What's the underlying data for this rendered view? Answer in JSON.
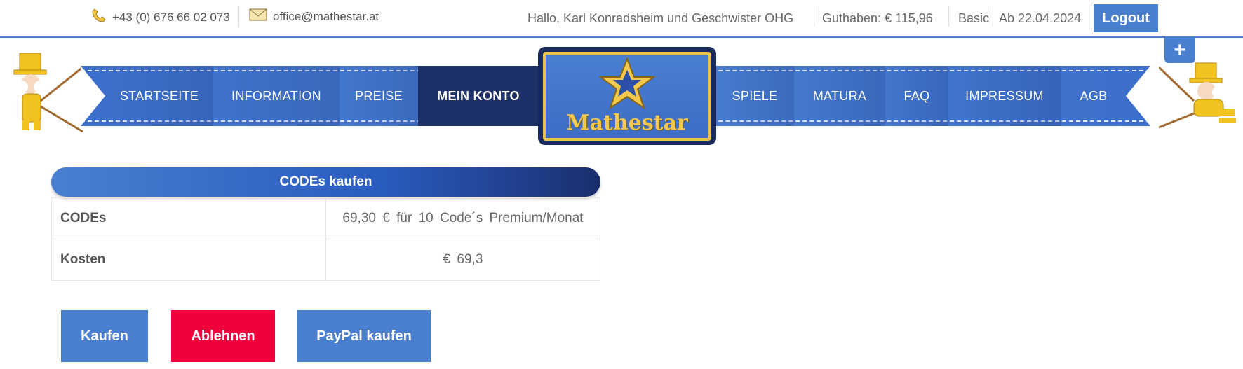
{
  "topbar": {
    "phone": "+43 (0) 676 66 02 073",
    "email": "office@mathestar.at",
    "greeting": "Hallo, Karl Konradsheim und Geschwister OHG",
    "balance": "Guthaben: € 115,96",
    "plan": "Basic",
    "since": "Ab 22.04.2024",
    "logout_label": "Logout",
    "plus_label": "+"
  },
  "nav": {
    "left": [
      "STARTSEITE",
      "INFORMATION",
      "PREISE",
      "MEIN KONTO"
    ],
    "right": [
      "SPIELE",
      "MATURA",
      "FAQ",
      "IMPRESSUM",
      "AGB"
    ],
    "active": "MEIN KONTO"
  },
  "logo": {
    "text": "Mathestar"
  },
  "codes": {
    "header": "CODEs kaufen",
    "rows": [
      {
        "label": "CODEs",
        "value": "69,30 € für 10 Code´s Premium/Monat"
      },
      {
        "label": "Kosten",
        "value": "€ 69,3"
      }
    ]
  },
  "actions": {
    "buy": "Kaufen",
    "decline": "Ablehnen",
    "paypal": "PayPal kaufen"
  },
  "colors": {
    "accent": "#4a7fd0",
    "active_nav": "#1c2f66",
    "decline": "#f0003c",
    "gold": "#e8c24a"
  }
}
